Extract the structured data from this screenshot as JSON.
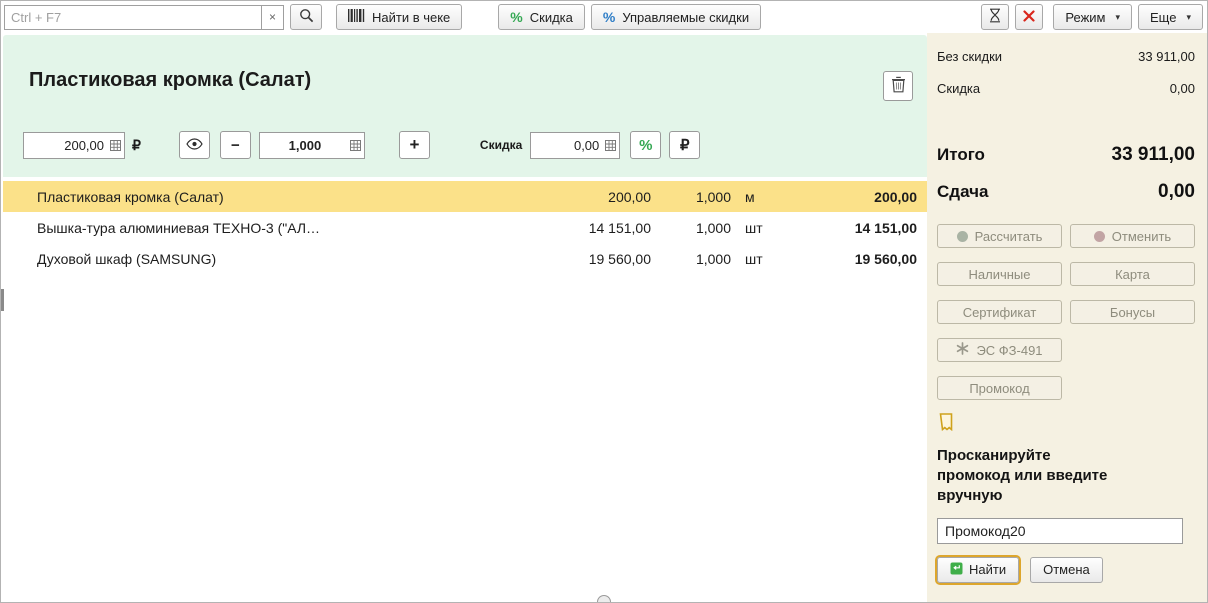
{
  "toolbar": {
    "search_placeholder": "Ctrl + F7",
    "clear_label": "×",
    "find_in_receipt_label": "Найти в чеке",
    "discount_label": "Скидка",
    "managed_discounts_label": "Управляемые скидки",
    "mode_label": "Режим",
    "more_label": "Еще",
    "percent_glyph": "%",
    "caret_glyph": "▾"
  },
  "product_panel": {
    "title": "Пластиковая кромка (Салат)",
    "price_value": "200,00",
    "currency_ruble": "₽",
    "minus_label": "−",
    "quantity_value": "1,000",
    "plus_label": "+",
    "discount_label": "Скидка",
    "discount_value": "0,00",
    "percent_label": "%",
    "ruble_label": "₽"
  },
  "receipt": {
    "rows": [
      {
        "name": "Пластиковая кромка (Салат)",
        "price": "200,00",
        "qty": "1,000",
        "unit": "м",
        "total": "200,00",
        "selected": true
      },
      {
        "name": "Вышка-тура алюминиевая ТЕХНО-3 (\"АЛ…",
        "price": "14 151,00",
        "qty": "1,000",
        "unit": "шт",
        "total": "14 151,00",
        "selected": false
      },
      {
        "name": "Духовой шкаф (SAMSUNG)",
        "price": "19 560,00",
        "qty": "1,000",
        "unit": "шт",
        "total": "19 560,00",
        "selected": false
      }
    ]
  },
  "summary": {
    "no_discount_label": "Без скидки",
    "no_discount_value": "33 911,00",
    "discount_label": "Скидка",
    "discount_value": "0,00",
    "total_label": "Итого",
    "total_value": "33 911,00",
    "change_label": "Сдача",
    "change_value": "0,00"
  },
  "payment_buttons": {
    "calculate": "Рассчитать",
    "cancel": "Отменить",
    "cash": "Наличные",
    "card": "Карта",
    "certificate": "Сертификат",
    "bonuses": "Бонусы",
    "es_fz491": "ЭС ФЗ-491",
    "promocode": "Промокод"
  },
  "promo_section": {
    "instruction": "Просканируйте промокод или введите вручную",
    "input_value": "Промокод20",
    "find_label": "Найти",
    "cancel_label": "Отмена"
  },
  "colors": {
    "panel_green": "#e3f5e9",
    "selected_row_yellow": "#fbe189",
    "sidebar_cream": "#f5f1e2",
    "accent_red": "#d9261c",
    "accent_green": "#35a854",
    "accent_blue": "#2f7ec7",
    "focus_orange": "#dda62c",
    "ticket_gold": "#cfa21c"
  }
}
